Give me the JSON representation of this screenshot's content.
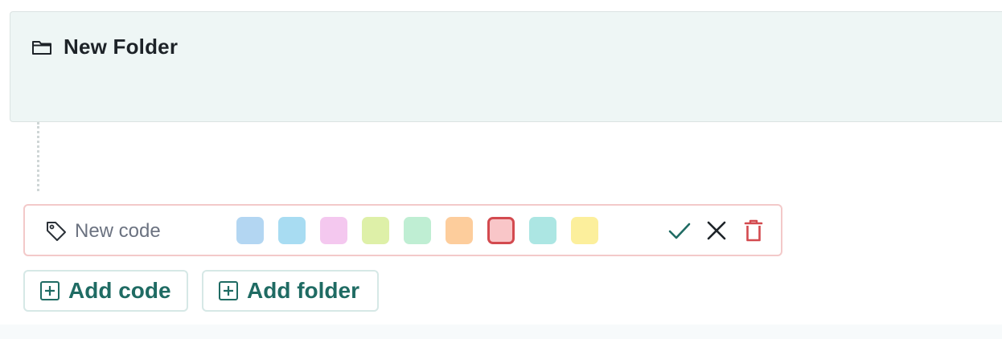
{
  "folder": {
    "title": "New Folder",
    "icon": "folder-icon"
  },
  "code_editor": {
    "placeholder": "New code",
    "tag_icon": "tag-icon",
    "swatches": [
      {
        "name": "blue",
        "color": "#b3d6f2",
        "selected": false
      },
      {
        "name": "sky",
        "color": "#a8dcf2",
        "selected": false
      },
      {
        "name": "pink",
        "color": "#f4c8ef",
        "selected": false
      },
      {
        "name": "lime",
        "color": "#def0a8",
        "selected": false
      },
      {
        "name": "mint",
        "color": "#bfeed3",
        "selected": false
      },
      {
        "name": "orange",
        "color": "#fdcd9c",
        "selected": false
      },
      {
        "name": "rose",
        "color": "#f9c6c8",
        "selected": true
      },
      {
        "name": "teal",
        "color": "#ace6e3",
        "selected": false
      },
      {
        "name": "yellow",
        "color": "#fcef9c",
        "selected": false
      }
    ],
    "actions": {
      "confirm_icon": "check-icon",
      "cancel_icon": "close-icon",
      "delete_icon": "trash-icon"
    }
  },
  "buttons": {
    "add_code": "Add code",
    "add_folder": "Add folder"
  },
  "colors": {
    "accent": "#1f6b63",
    "danger": "#d34a4f"
  }
}
